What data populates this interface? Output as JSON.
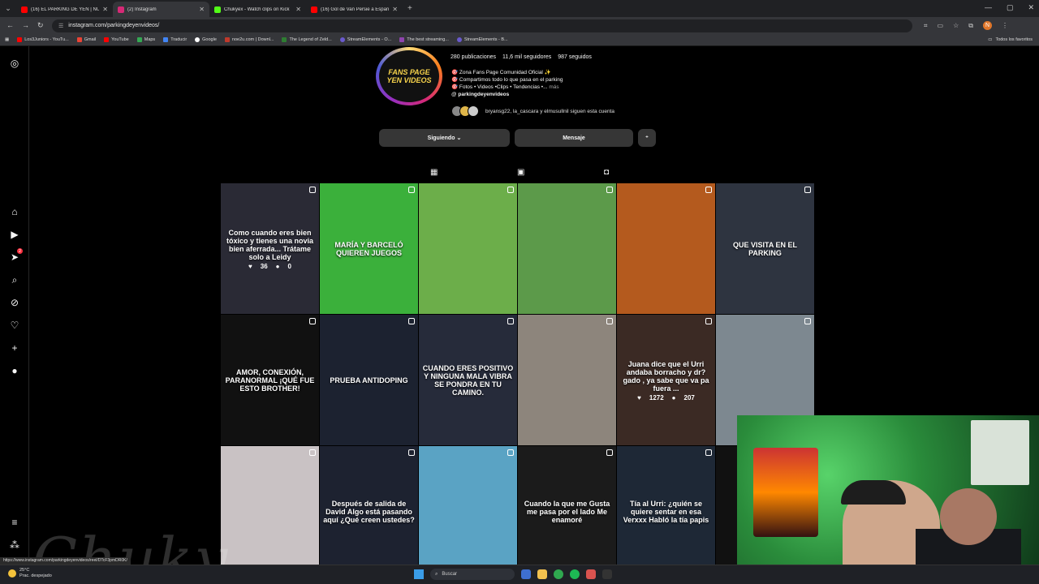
{
  "browser": {
    "tabs": [
      {
        "title": "(16) EL PARKING DE YEN | NUE",
        "favicon_color": "#ff0000"
      },
      {
        "title": "(2) Instagram",
        "favicon_color": "#d62976"
      },
      {
        "title": "Chukyex - Watch clips on Kick",
        "favicon_color": "#53fc18"
      },
      {
        "title": "(16) Gol de Van Persie a España",
        "favicon_color": "#ff0000"
      }
    ],
    "url": "instagram.com/parkingdeyenvideos/",
    "bookmarks": [
      {
        "label": "Los3Juniors - YouTu...",
        "color": "#ff0000"
      },
      {
        "label": "Gmail",
        "color": "#ea4335"
      },
      {
        "label": "YouTube",
        "color": "#ff0000"
      },
      {
        "label": "Maps",
        "color": "#34a853"
      },
      {
        "label": "Traducir",
        "color": "#4285f4"
      },
      {
        "label": "Google",
        "color": "#ffffff"
      },
      {
        "label": "noe2u.com | Downl...",
        "color": "#c0392b"
      },
      {
        "label": "The Legend of Zeld...",
        "color": "#2e7d32"
      },
      {
        "label": "StreamElements - O...",
        "color": "#6a5acd"
      },
      {
        "label": "The best streaming...",
        "color": "#8e44ad"
      },
      {
        "label": "StreamElements - B...",
        "color": "#6a5acd"
      }
    ],
    "all_bookmarks": "Todos los favoritos",
    "profile_initial": "N"
  },
  "profile": {
    "pic_line1": "FANS PAGE",
    "pic_line2": "YEN VIDEOS",
    "posts": "280 publicaciones",
    "followers": "11,6 mil seguidores",
    "following": "987 seguidos",
    "bio1": "Zona Fans Page Comunidad Oficial",
    "bio2": "Compartimos todo lo que pasa en el parking",
    "bio3": "Fotos • Videos •Clips • Tendencias •...",
    "bio3_more": "más",
    "bio_handle": "parkingdeyenvideos",
    "followed_by": "bryansg22, la_cascara y elmusullnil siguen esta cuenta",
    "btn_following": "Siguiendo",
    "btn_message": "Mensaje"
  },
  "posts": [
    {
      "caption": "Como cuando eres bien tóxico y tienes una novia bien aferrada... Trátame solo a Leidy",
      "bg": "#2a2a35",
      "likes": "36",
      "comments": "0"
    },
    {
      "caption": "MARÍA Y BARCELÓ QUIEREN JUEGOS",
      "bg": "#3bb03b"
    },
    {
      "caption": "",
      "bg": "#6cae4a"
    },
    {
      "caption": "",
      "bg": "#5c9a4a"
    },
    {
      "caption": "",
      "bg": "#b45a1e"
    },
    {
      "caption": "QUE VISITA  EN EL PARKING",
      "bg": "#2e3440"
    },
    {
      "caption": "AMOR, CONEXIÓN, PARANORMAL  ¡QUÉ FUE ESTO BROTHER!",
      "bg": "#111111"
    },
    {
      "caption": "PRUEBA ANTIDOPING",
      "bg": "#1c2230"
    },
    {
      "caption": "CUANDO ERES POSITIVO Y NINGUNA MALA VIBRA SE PONDRA EN TU CAMINO.",
      "bg": "#262b3a"
    },
    {
      "caption": "",
      "bg": "#8d857c"
    },
    {
      "caption": "Juana dice que el Urri andaba borracho y dr?gado , ya sabe que va pa fuera ...",
      "bg": "#3b2a24",
      "likes": "1272",
      "comments": "207"
    },
    {
      "caption": "",
      "bg": "#7d8890"
    },
    {
      "caption": "",
      "bg": "#c9c2c4"
    },
    {
      "caption": "Después de salida de David Algo está pasando aquí  ¿Qué creen ustedes?",
      "bg": "#1d2230"
    },
    {
      "caption": "",
      "bg": "#5aa3c4"
    },
    {
      "caption": "Cuando la que me Gusta me pasa por el lado  Me enamoré",
      "bg": "#1b1b1b"
    },
    {
      "caption": "Tía al Urri: ¿quién se quiere sentar en esa Verxxx  Habló la tía papis",
      "bg": "#1e2836"
    },
    {
      "caption": "",
      "bg": "#111111"
    }
  ],
  "status_url": "https://www.instagram.com/parkingdeyenvideos/reel/DTcF3pmDR0K/",
  "taskbar": {
    "temp": "25°C",
    "weather": "Prac. despejado",
    "search": "Buscar"
  },
  "watermark": "Chuky"
}
